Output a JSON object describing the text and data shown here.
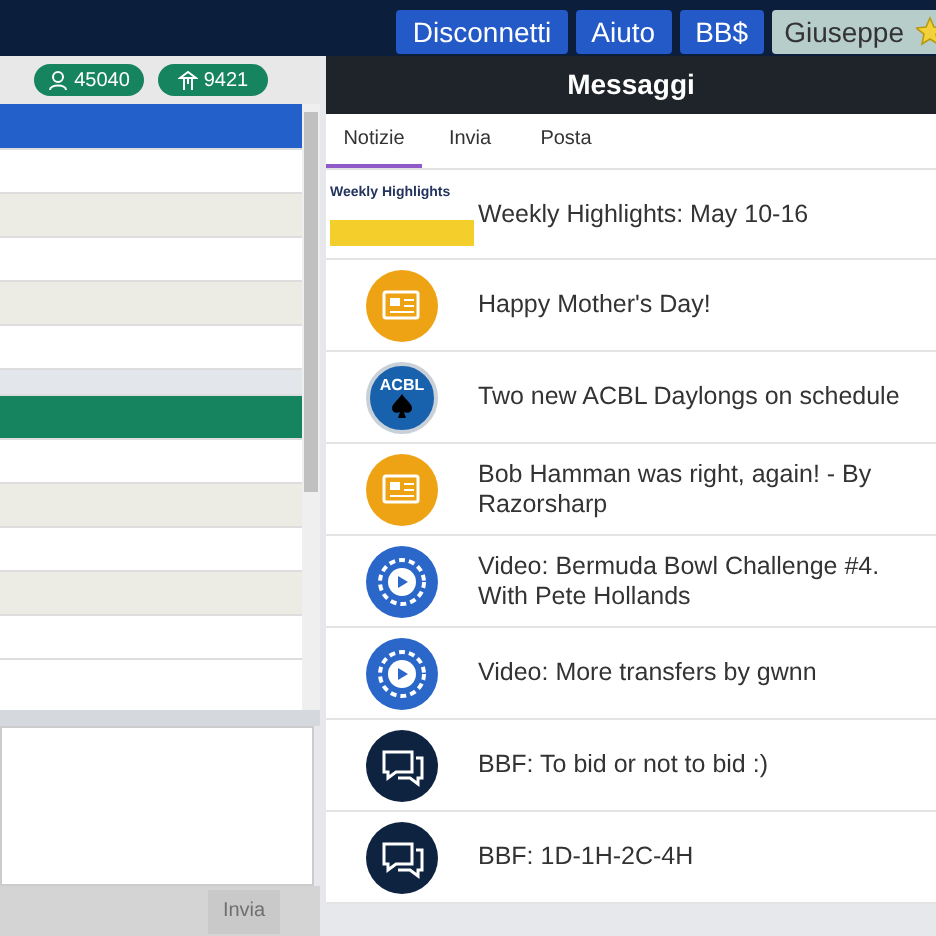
{
  "navbar": {
    "buttons": [
      {
        "label": "Disconnetti",
        "kind": "primary"
      },
      {
        "label": "Aiuto",
        "kind": "primary"
      },
      {
        "label": "BB$",
        "kind": "primary"
      },
      {
        "label": "Giuseppe",
        "kind": "user"
      }
    ]
  },
  "left_panel": {
    "counters": [
      {
        "value": "45040"
      },
      {
        "value": "9421"
      }
    ],
    "rows": [
      {
        "kind": "header"
      },
      {
        "kind": "row"
      },
      {
        "kind": "row"
      },
      {
        "kind": "row"
      },
      {
        "kind": "row"
      },
      {
        "kind": "row"
      },
      {
        "kind": "section"
      },
      {
        "kind": "highlight"
      },
      {
        "kind": "row"
      },
      {
        "kind": "row"
      },
      {
        "kind": "row"
      },
      {
        "kind": "row"
      },
      {
        "kind": "row"
      }
    ],
    "send_button": {
      "label": "Invia",
      "disabled": true
    }
  },
  "messages": {
    "title": "Messaggi",
    "tabs": [
      {
        "label": "Notizie",
        "selected": true
      },
      {
        "label": "Invia",
        "selected": false
      },
      {
        "label": "Posta",
        "selected": false
      }
    ],
    "items": [
      {
        "kind": "highlights",
        "badge": "Weekly Highlights",
        "text": "Weekly Highlights: May 10-16"
      },
      {
        "kind": "news",
        "text": "Happy Mother's Day!"
      },
      {
        "kind": "acbl",
        "badge": "ACBL",
        "text": "Two new ACBL Daylongs on schedule"
      },
      {
        "kind": "news",
        "text": "Bob Hamman was right, again! - By Razorsharp"
      },
      {
        "kind": "video",
        "text": "Video: Bermuda Bowl Challenge #4. With Pete Hollands"
      },
      {
        "kind": "video",
        "text": "Video: More transfers by gwnn"
      },
      {
        "kind": "forum",
        "text": "BBF: To bid or not to bid :)"
      },
      {
        "kind": "forum",
        "text": "BBF: 1D-1H-2C-4H"
      }
    ]
  }
}
